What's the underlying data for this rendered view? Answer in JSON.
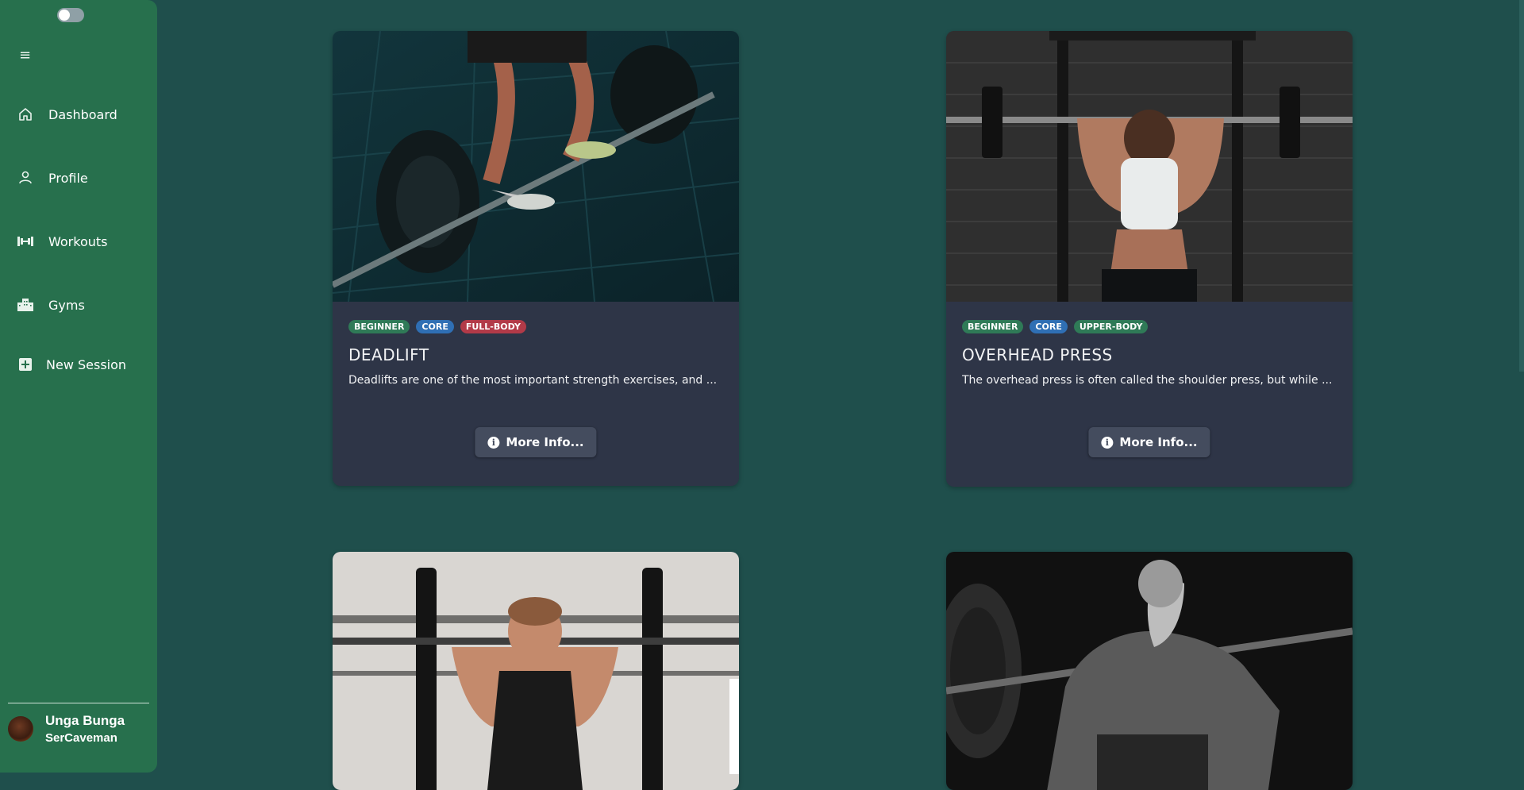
{
  "sidebar": {
    "nav": [
      {
        "label": "Dashboard",
        "icon": "home-icon"
      },
      {
        "label": "Profile",
        "icon": "user-icon"
      },
      {
        "label": "Workouts",
        "icon": "dumbbell-icon"
      },
      {
        "label": "Gyms",
        "icon": "building-icon"
      },
      {
        "label": "New Session",
        "icon": "plus-square-icon"
      }
    ],
    "user": {
      "name": "Unga Bunga",
      "username": "SerCaveman"
    }
  },
  "cards": [
    {
      "tags": [
        "BEGINNER",
        "CORE",
        "FULL-BODY"
      ],
      "title": "DEADLIFT",
      "description": "Deadlifts are one of the most important strength exercises, and ...",
      "button": "More Info..."
    },
    {
      "tags": [
        "BEGINNER",
        "CORE",
        "UPPER-BODY"
      ],
      "title": "OVERHEAD PRESS",
      "description": "The overhead press is often called the shoulder press, but while ...",
      "button": "More Info..."
    }
  ],
  "colors": {
    "background": "#1f4f4c",
    "sidebar": "#27704d",
    "card": "#2e3547",
    "tag_green": "#2f7a57",
    "tag_blue": "#2f6fb4",
    "tag_red": "#b23a48"
  }
}
